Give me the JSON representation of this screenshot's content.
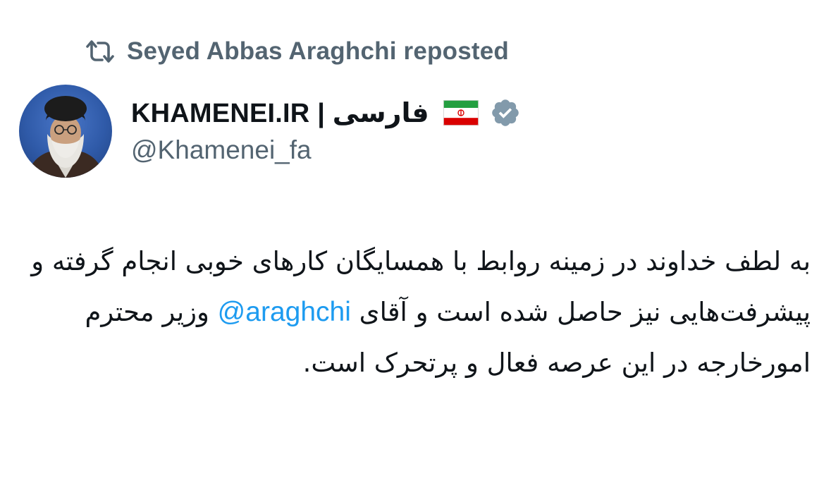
{
  "repost": {
    "icon": "repost-icon",
    "text": "Seyed Abbas Araghchi reposted"
  },
  "author": {
    "display_name": "KHAMENEI.IR | فارسی",
    "flag": "iran-flag-icon",
    "verified_icon": "verified-badge-icon",
    "handle": "@Khamenei_fa"
  },
  "tweet": {
    "text_before": "به لطف خداوند در زمینه روابط با همسایگان کارهای خوبی انجام گرفته و پیشرفت‌هایی نیز حاصل شده است و آقای",
    "mention": "@araghchi",
    "text_after": "وزیر محترم امورخارجه در این عرصه فعال و پرتحرک است."
  },
  "colors": {
    "text_primary": "#0f1419",
    "text_secondary": "#536471",
    "link": "#1d9bf0",
    "verified_badge": "#829aab"
  }
}
